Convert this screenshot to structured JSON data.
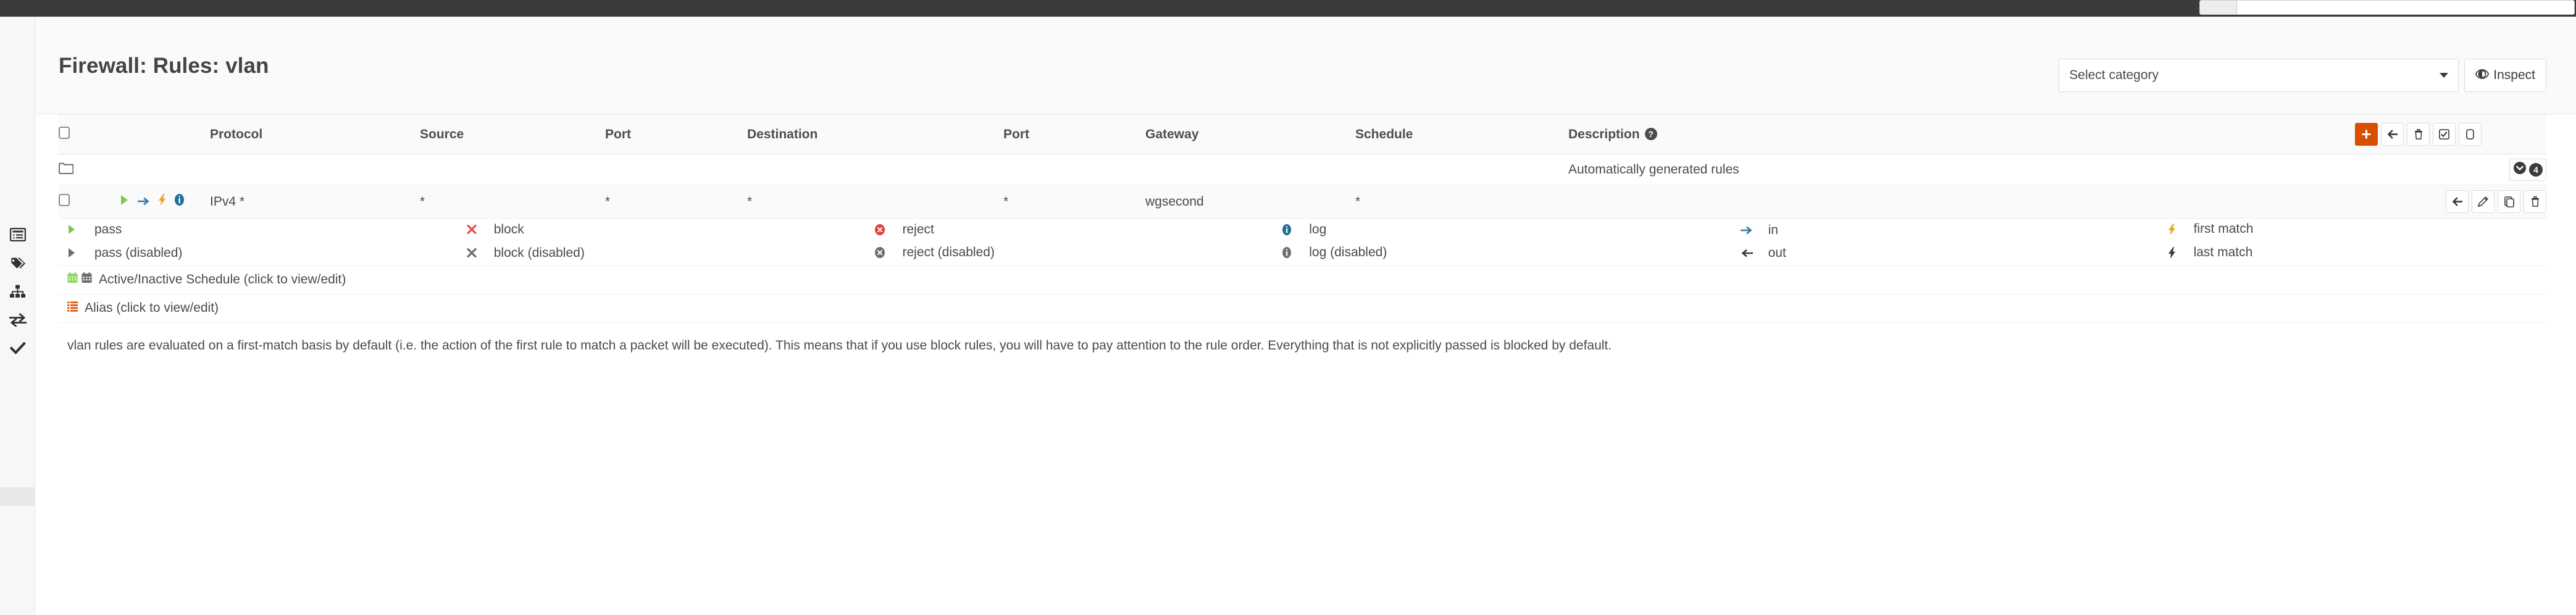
{
  "topbar": {
    "search_placeholder": ""
  },
  "sidebar": {
    "items": [
      {
        "name": "logs-icon",
        "label": "Logs"
      },
      {
        "name": "tags-icon",
        "label": "Aliases"
      },
      {
        "name": "sitemap-icon",
        "label": "Groups"
      },
      {
        "name": "exchange-icon",
        "label": "NAT"
      },
      {
        "name": "check-icon",
        "label": "Apply"
      }
    ]
  },
  "header": {
    "title": "Firewall: Rules: vlan",
    "category_select": "Select category",
    "inspect_label": "Inspect",
    "inspect_icon": "eye-icon",
    "caret_icon": "chevron-down-icon"
  },
  "table": {
    "columns": [
      "",
      "",
      "Protocol",
      "Source",
      "Port",
      "Destination",
      "Port",
      "Gateway",
      "Schedule",
      "Description",
      ""
    ],
    "description_help_icon": "question-mark-icon",
    "header_actions": [
      {
        "name": "add-rule-button",
        "icon": "plus-icon",
        "style": "primary"
      },
      {
        "name": "move-rules-button",
        "icon": "arrow-left-icon",
        "style": "default"
      },
      {
        "name": "delete-selected-button",
        "icon": "trash-icon",
        "style": "default"
      },
      {
        "name": "select-all-button",
        "icon": "checked-box-icon",
        "style": "default"
      },
      {
        "name": "deselect-all-button",
        "icon": "empty-box-icon",
        "style": "default"
      }
    ],
    "group_row": {
      "folder_icon": "folder-icon",
      "description": "Automatically generated rules",
      "collapse_icon": "chevron-down-circle-icon",
      "count": "4"
    },
    "rule_row": {
      "checkbox": "",
      "icons": [
        "pass-arrow-icon",
        "direction-in-icon",
        "first-match-icon",
        "log-icon"
      ],
      "protocol": "IPv4 *",
      "source": "*",
      "source_port": "*",
      "destination": "*",
      "destination_port": "*",
      "gateway": "wgsecond",
      "schedule": "*",
      "description": "",
      "actions": [
        {
          "name": "move-rule-button",
          "icon": "arrow-left-icon"
        },
        {
          "name": "edit-rule-button",
          "icon": "pencil-icon"
        },
        {
          "name": "clone-rule-button",
          "icon": "clone-icon"
        },
        {
          "name": "delete-rule-button",
          "icon": "trash-icon"
        }
      ]
    }
  },
  "legend": {
    "rows": [
      [
        {
          "icon": "pass-triangle-icon",
          "label": "pass",
          "color": "#7dc855"
        },
        {
          "icon": "block-x-icon",
          "label": "block",
          "color": "#e04f4f"
        },
        {
          "icon": "reject-circle-icon",
          "label": "reject",
          "color": "#e0413c"
        },
        {
          "icon": "log-info-icon",
          "label": "log",
          "color": "#1f6f99"
        },
        {
          "icon": "direction-in-icon",
          "label": "in",
          "color": "#2f77a8"
        },
        {
          "icon": "first-match-bolt-icon",
          "label": "first match",
          "color": "#f0a128"
        }
      ],
      [
        {
          "icon": "pass-triangle-disabled-icon",
          "label": "pass (disabled)",
          "color": "#6e6e6e"
        },
        {
          "icon": "block-x-disabled-icon",
          "label": "block (disabled)",
          "color": "#6e6e6e"
        },
        {
          "icon": "reject-circle-disabled-icon",
          "label": "reject (disabled)",
          "color": "#6e6e6e"
        },
        {
          "icon": "log-info-disabled-icon",
          "label": "log (disabled)",
          "color": "#6e6e6e"
        },
        {
          "icon": "direction-out-icon",
          "label": "out",
          "color": "#3a3a3a"
        },
        {
          "icon": "last-match-bolt-icon",
          "label": "last match",
          "color": "#3a3a3a"
        }
      ]
    ]
  },
  "helpers": [
    {
      "name": "schedule-helper",
      "icons": [
        "calendar-active-icon",
        "calendar-inactive-icon"
      ],
      "label": "Active/Inactive Schedule (click to view/edit)"
    },
    {
      "name": "alias-helper",
      "icons": [
        "alias-list-icon"
      ],
      "label": "Alias (click to view/edit)"
    }
  ],
  "footer": {
    "note": "vlan rules are evaluated on a first-match basis by default (i.e. the action of the first rule to match a packet will be executed). This means that if you use block rules, you will have to pay attention to the rule order. Everything that is not explicitly passed is blocked by default."
  },
  "colors": {
    "accent": "#d94f00",
    "pass": "#7dc855",
    "block": "#e04f4f",
    "reject": "#e0413c",
    "log": "#1f6f99",
    "in": "#2f77a8",
    "bolt": "#f0a128",
    "disabled": "#6e6e6e",
    "topbar": "#3b3b3b"
  }
}
